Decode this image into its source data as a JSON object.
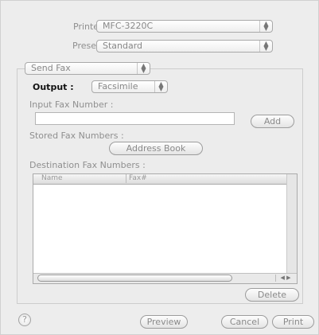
{
  "printer": {
    "label": "Printer:",
    "value": "MFC-3220C"
  },
  "presets": {
    "label": "Presets:",
    "value": "Standard"
  },
  "panel": {
    "value": "Send Fax"
  },
  "output": {
    "label": "Output :",
    "value": "Facsimile"
  },
  "input_fax": {
    "label": "Input Fax Number :",
    "value": "",
    "add_label": "Add"
  },
  "stored": {
    "label": "Stored Fax Numbers :",
    "address_book_label": "Address Book"
  },
  "destination": {
    "label": "Destination Fax Numbers :",
    "columns": [
      "Name",
      "Fax#"
    ],
    "rows": [],
    "delete_label": "Delete"
  },
  "footer": {
    "help_label": "?",
    "preview_label": "Preview",
    "cancel_label": "Cancel",
    "print_label": "Print"
  },
  "icons": {
    "popup_arrows": "updown-arrows-icon",
    "scroll_arrows": "left-right-arrows-icon"
  }
}
